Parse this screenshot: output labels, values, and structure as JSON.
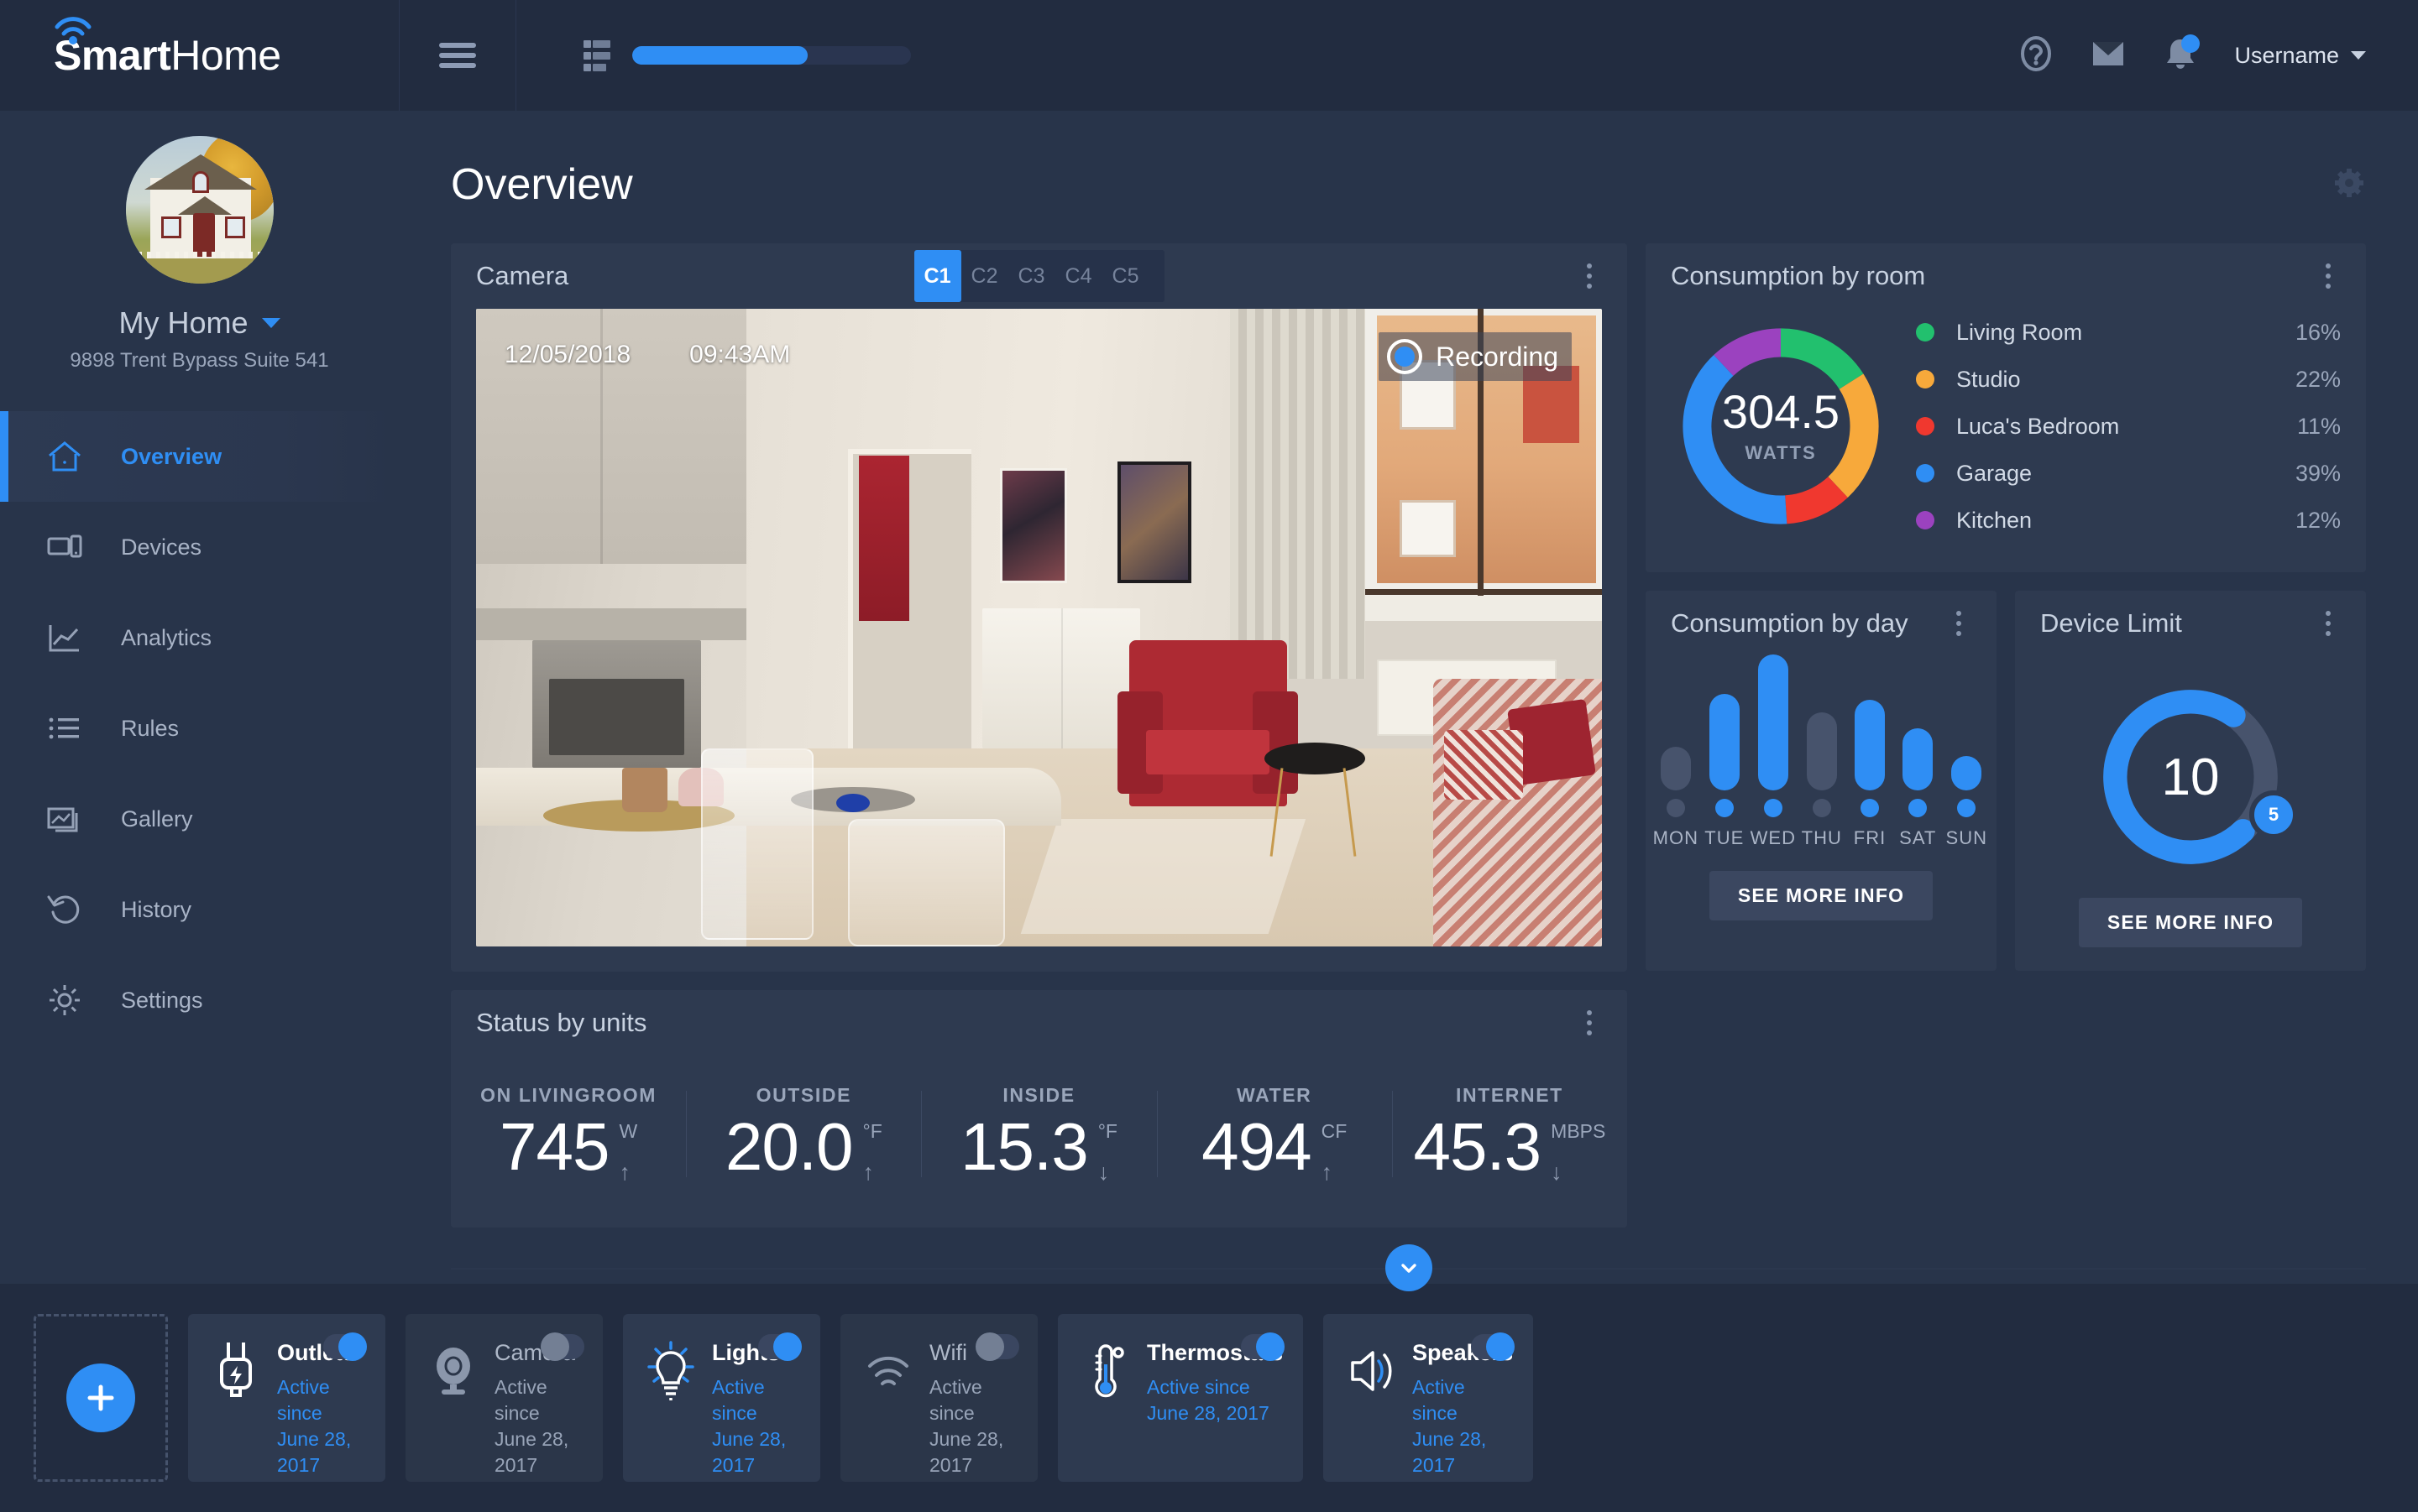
{
  "brand": {
    "bold": "Smart",
    "light": "Home",
    "wifi_icon": "wifi-icon"
  },
  "topbar": {
    "hamburger_icon": "hamburger-icon",
    "meter_icon": "list-meter-icon",
    "meter_percent": 63,
    "help_icon": "help-circle-icon",
    "mail_icon": "envelope-icon",
    "bell_icon": "bell-icon",
    "username": "Username",
    "caret_icon": "chevron-down-icon"
  },
  "sidebar": {
    "avatar_name": "house-avatar",
    "home_name": "My Home",
    "home_address": "9898 Trent Bypass Suite 541",
    "items": [
      {
        "label": "Overview",
        "icon": "home-icon",
        "active": true
      },
      {
        "label": "Devices",
        "icon": "devices-icon",
        "active": false
      },
      {
        "label": "Analytics",
        "icon": "chart-line-icon",
        "active": false
      },
      {
        "label": "Rules",
        "icon": "list-icon",
        "active": false
      },
      {
        "label": "Gallery",
        "icon": "image-icon",
        "active": false
      },
      {
        "label": "History",
        "icon": "undo-arrow-icon",
        "active": false
      },
      {
        "label": "Settings",
        "icon": "gear-icon",
        "active": false
      }
    ]
  },
  "page": {
    "title": "Overview",
    "settings_icon": "gear-icon"
  },
  "camera": {
    "title": "Camera",
    "tabs": [
      "C1",
      "C2",
      "C3",
      "C4",
      "C5"
    ],
    "active_tab": "C1",
    "date": "12/05/2018",
    "time": "09:43AM",
    "recording_label": "Recording",
    "record_icon": "record-dot-icon",
    "menu_icon": "kebab-menu-icon"
  },
  "consumption_by_room": {
    "title": "Consumption by room",
    "menu_icon": "kebab-menu-icon",
    "center_value": "304.5",
    "center_unit": "WATTS"
  },
  "consumption_by_day": {
    "title": "Consumption by day",
    "menu_icon": "kebab-menu-icon",
    "see_more_label": "SEE MORE INFO"
  },
  "device_limit": {
    "title": "Device Limit",
    "menu_icon": "kebab-menu-icon",
    "value": "10",
    "badge": "5",
    "see_more_label": "SEE MORE INFO"
  },
  "status_by_units": {
    "title": "Status by units",
    "menu_icon": "kebab-menu-icon",
    "units": [
      {
        "label": "ON LIVINGROOM",
        "value": "745",
        "unit": "W",
        "trend": "↑"
      },
      {
        "label": "OUTSIDE",
        "value": "20.0",
        "unit": "°F",
        "trend": "↑"
      },
      {
        "label": "INSIDE",
        "value": "15.3",
        "unit": "°F",
        "trend": "↓"
      },
      {
        "label": "WATER",
        "value": "494",
        "unit": "CF",
        "trend": "↑"
      },
      {
        "label": "INTERNET",
        "value": "45.3",
        "unit": "MBPS",
        "trend": "↓"
      }
    ]
  },
  "collapse": {
    "icon": "chevron-down-icon"
  },
  "dock": {
    "add_icon": "plus-icon",
    "devices": [
      {
        "name": "Outlets",
        "icon": "plug-icon",
        "since_label": "Active since",
        "since_date": "June 28, 2017",
        "on": true
      },
      {
        "name": "Camera",
        "icon": "webcam-icon",
        "since_label": "Active since",
        "since_date": "June 28, 2017",
        "on": false
      },
      {
        "name": "Lights",
        "icon": "lightbulb-icon",
        "since_label": "Active since",
        "since_date": "June 28, 2017",
        "on": true
      },
      {
        "name": "Wifi",
        "icon": "wifi-icon",
        "since_label": "Active since",
        "since_date": "June 28, 2017",
        "on": false
      },
      {
        "name": "Thermostats",
        "icon": "thermometer-icon",
        "since_label": "Active since",
        "since_date": "June 28, 2017",
        "on": true
      },
      {
        "name": "Speakers",
        "icon": "speaker-icon",
        "since_label": "Active since",
        "since_date": "June 28, 2017",
        "on": true
      }
    ]
  },
  "colors": {
    "accent": "#2f8ef4",
    "page_bg": "#28344a",
    "card_bg": "#2e3a50",
    "chrome_bg": "#222c40",
    "green": "#22c06e",
    "orange": "#f7a93b",
    "red": "#f0382f",
    "blue": "#2f8ef4",
    "purple": "#9b42bf",
    "muted": "#47536c"
  },
  "chart_data": [
    {
      "type": "pie",
      "title": "Consumption by room",
      "center_value": 304.5,
      "center_unit": "WATTS",
      "categories": [
        "Living Room",
        "Studio",
        "Luca's Bedroom",
        "Garage",
        "Kitchen"
      ],
      "values": [
        16,
        22,
        11,
        39,
        12
      ],
      "value_labels": [
        "16%",
        "22%",
        "11%",
        "39%",
        "12%"
      ],
      "colors": [
        "#22c06e",
        "#f7a93b",
        "#f0382f",
        "#2f8ef4",
        "#9b42bf"
      ],
      "legend": "right",
      "donut": true
    },
    {
      "type": "bar",
      "title": "Consumption by day",
      "categories": [
        "MON",
        "TUE",
        "WED",
        "THU",
        "FRI",
        "SAT",
        "SUN"
      ],
      "values": [
        28,
        62,
        87,
        50,
        58,
        40,
        22
      ],
      "ylim": [
        0,
        100
      ],
      "active": [
        false,
        true,
        true,
        false,
        true,
        true,
        true
      ],
      "active_color": "#2f8ef4",
      "inactive_color": "#47536c",
      "grid": false,
      "xlabel": "",
      "ylabel": ""
    },
    {
      "type": "pie",
      "title": "Device Limit",
      "donut": true,
      "value": 10,
      "badge": 5,
      "percent_filled": 72,
      "track_color": "#47536c",
      "fill_color": "#2f8ef4"
    }
  ]
}
